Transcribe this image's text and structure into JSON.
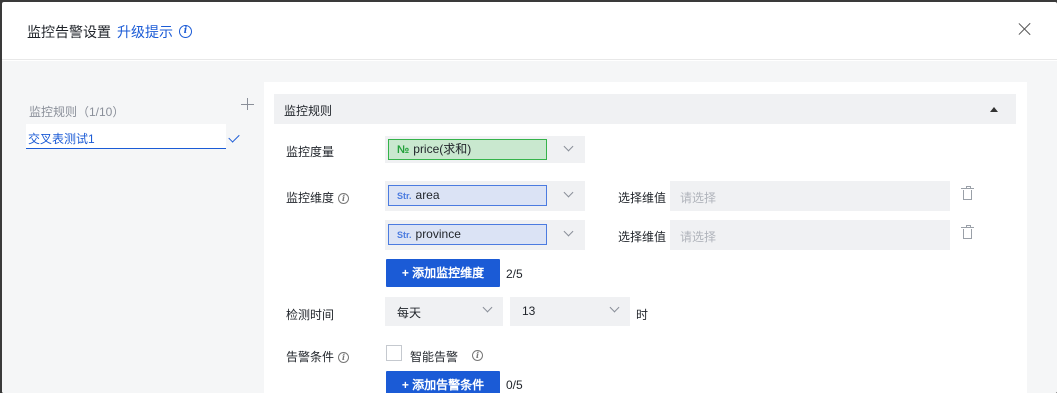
{
  "dialog": {
    "title": "监控告警设置",
    "upgrade_link": "升级提示",
    "upgrade_icon": "info-icon",
    "close_icon": "close-icon"
  },
  "sidebar": {
    "title": "监控规则（1/10）",
    "add_icon": "plus-icon",
    "items": [
      {
        "label": "交叉表测试1",
        "selected": true,
        "icon": "check-icon"
      }
    ]
  },
  "section": {
    "title": "监控规则",
    "collapse_icon": "caret-up-icon"
  },
  "form": {
    "measure_label": "监控度量",
    "measure": {
      "tag": "№",
      "value": "price(求和)",
      "color": "#35b34a"
    },
    "dimension_label": "监控维度",
    "dimensions": [
      {
        "tag": "Str.",
        "value": "area",
        "value_label": "选择维值",
        "placeholder": "请选择"
      },
      {
        "tag": "Str.",
        "value": "province",
        "value_label": "选择维值",
        "placeholder": "请选择"
      }
    ],
    "add_dimension_button": "+ 添加监控维度",
    "dimension_count": "2/5",
    "check_time_label": "检测时间",
    "frequency": "每天",
    "hour": "13",
    "hour_unit": "时",
    "alert_condition_label": "告警条件",
    "smart_alert_label": "智能告警",
    "smart_alert_checked": false,
    "add_condition_button": "+ 添加告警条件",
    "condition_count": "0/5"
  },
  "colors": {
    "accent": "#1b5bd6",
    "measure_green": "#35b34a",
    "dimension_blue": "#4b7be0"
  }
}
